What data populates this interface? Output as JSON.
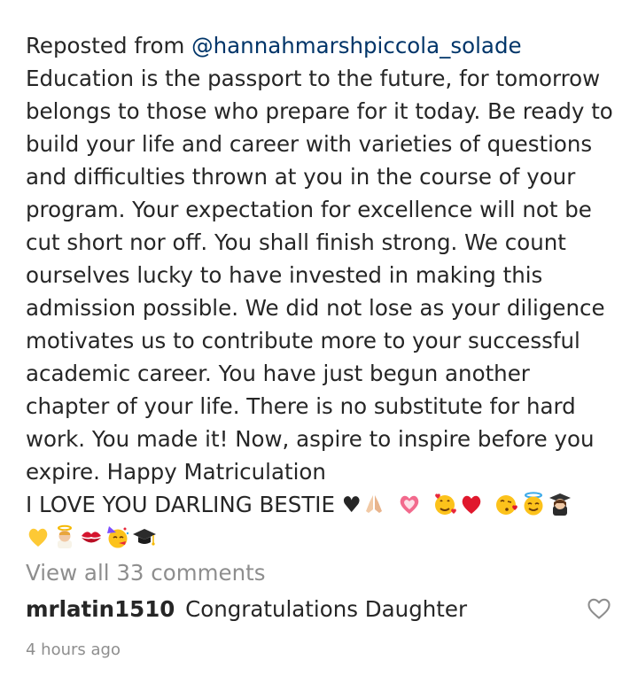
{
  "caption": {
    "reposted_prefix": "Reposted from ",
    "mention": "@hannahmarshpiccola_solade",
    "lines": [
      "Education is the passport to the future, for tomorrow",
      "belongs to those who prepare for it today. Be ready to",
      "build your life and career with varieties of questions",
      "and difficulties thrown at you in the course of your",
      "program. Your expectation for excellence will not be",
      "cut short nor off. You shall finish strong. We count",
      "ourselves lucky to have invested in making this",
      "admission possible. We did not lose as your diligence",
      "motivates us to contribute more to your successful",
      "academic career. You have just begun another",
      "chapter of your life. There is no substitute for hard",
      "work. You made it! Now, aspire to inspire before you",
      "expire. Happy Matriculation"
    ],
    "love_line": "I LOVE YOU DARLING BESTIE ♥",
    "emojis_line1": [
      "praying-hands-icon",
      "growing-heart-icon",
      "smiling-face-with-hearts-icon",
      "red-heart-icon",
      "face-blowing-kiss-icon",
      "smiling-face-with-halo-icon",
      "woman-student-icon"
    ],
    "emojis_line2": [
      "yellow-heart-icon",
      "baby-angel-icon",
      "kiss-mark-icon",
      "partying-face-icon",
      "graduation-cap-icon"
    ]
  },
  "comments": {
    "view_all_label": "View all 33 comments",
    "first": {
      "username": "mrlatin1510",
      "text": "Congratulations Daughter"
    }
  },
  "timestamp": "4 hours ago",
  "colors": {
    "text": "#262626",
    "mention": "#003569",
    "muted": "#8e8e8e"
  }
}
